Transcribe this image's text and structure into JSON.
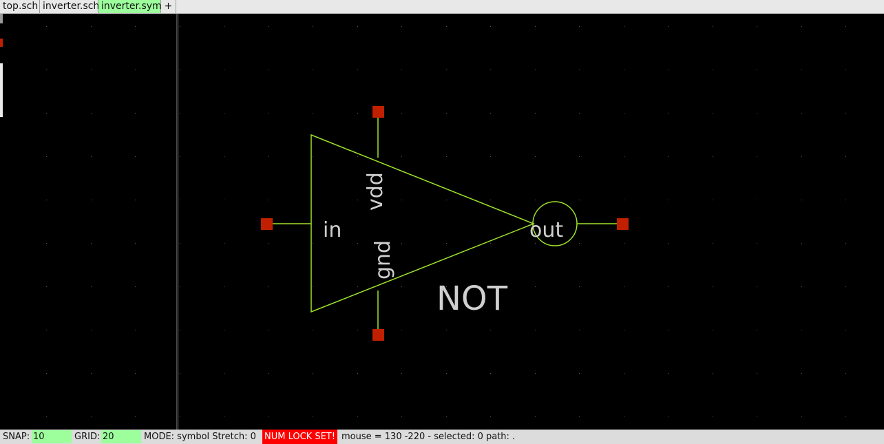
{
  "tabs": [
    {
      "label": "top.sch",
      "active": false
    },
    {
      "label": "inverter.sch",
      "active": false
    },
    {
      "label": "inverter.sym",
      "active": true
    }
  ],
  "add_tab_label": "+",
  "symbol": {
    "pins": {
      "in": "in",
      "out": "out",
      "vdd": "vdd",
      "gnd": "gnd"
    },
    "name": "NOT"
  },
  "colors": {
    "background": "#000000",
    "wire": "#9ee32b",
    "pin": "#c02000",
    "text": "#cfcfcf",
    "grid": "#5a5a5a"
  },
  "status": {
    "snap_label": "SNAP:",
    "snap_value": "10",
    "grid_label": "GRID:",
    "grid_value": "20",
    "mode": "MODE:  symbol  Stretch: 0",
    "numlock": "NUM LOCK SET!",
    "mouse": "mouse = 130 -220 - selected: 0 path: ."
  }
}
